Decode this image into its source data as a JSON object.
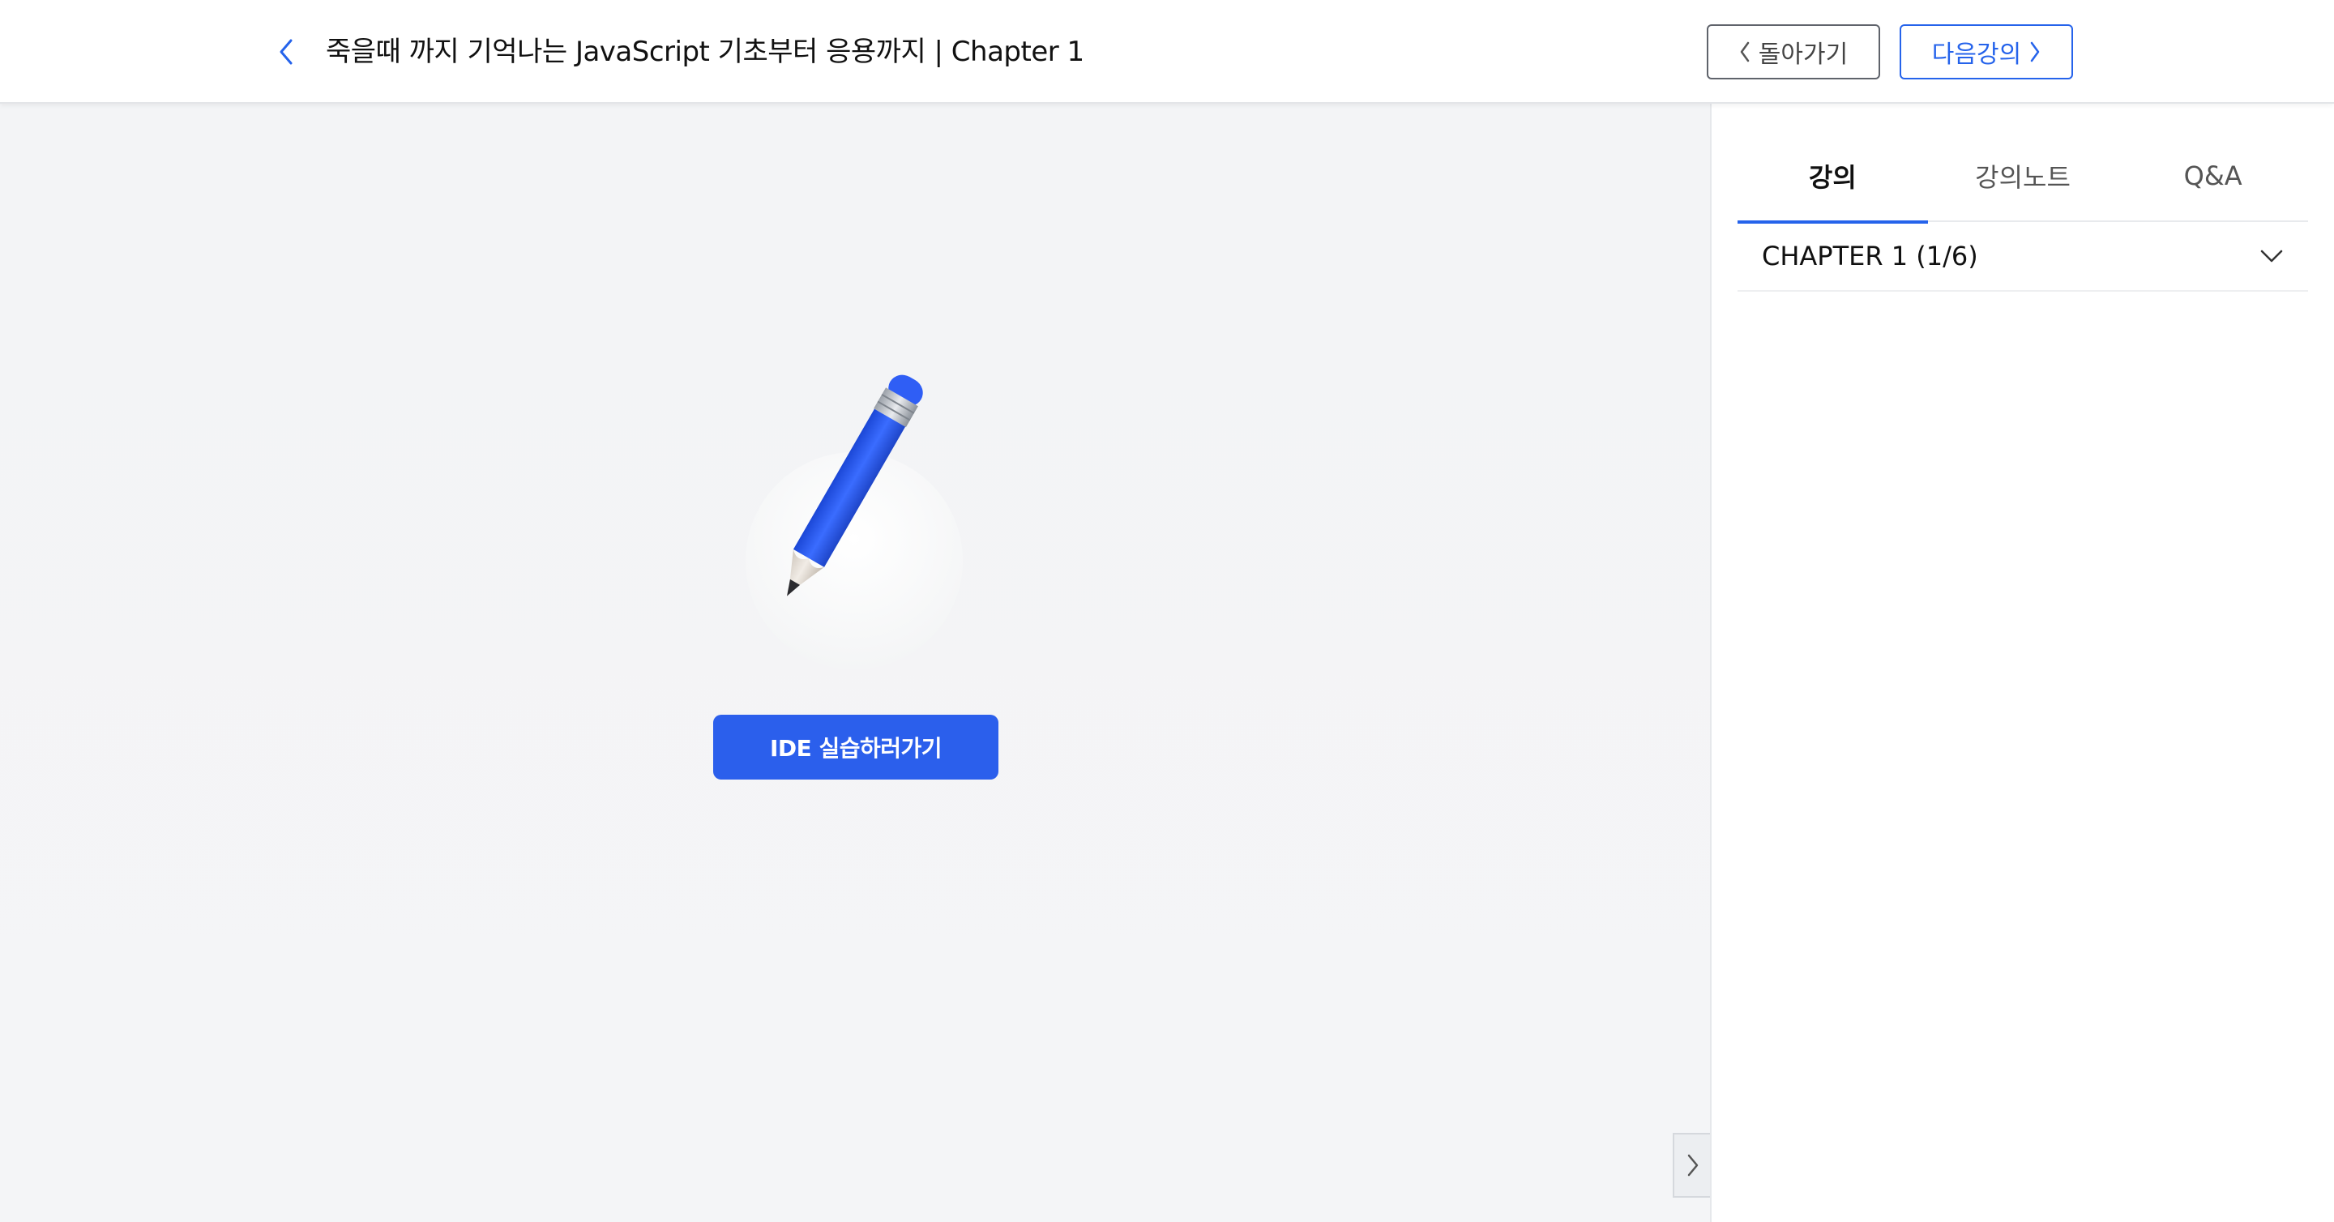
{
  "header": {
    "title": "죽을때 까지 기억나는 JavaScript 기초부터 응용까지 | Chapter 1",
    "back_label": "돌아가기",
    "next_label": "다음강의"
  },
  "main": {
    "ide_button_label": "IDE 실습하러가기",
    "illustration": "pencil-icon"
  },
  "sidebar": {
    "tabs": [
      {
        "label": "강의",
        "active": true
      },
      {
        "label": "강의노트",
        "active": false
      },
      {
        "label": "Q&A",
        "active": false
      }
    ],
    "chapter": {
      "label": "CHAPTER 1 (1/6)",
      "expanded": false
    }
  },
  "colors": {
    "accent": "#2563eb",
    "ide_button": "#2b5fec",
    "pencil_body": "#2f5ef5",
    "background": "#f3f4f6"
  }
}
